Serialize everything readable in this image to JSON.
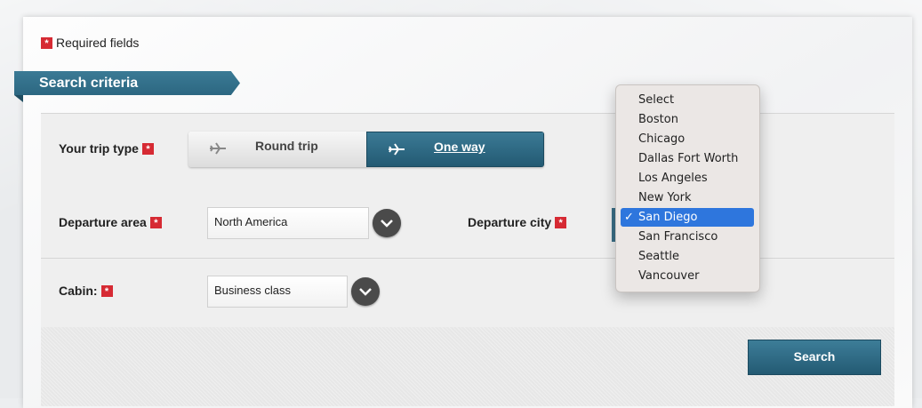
{
  "legend": {
    "required_text": "Required fields",
    "star": "*"
  },
  "section": {
    "title": "Search criteria"
  },
  "trip_type": {
    "label": "Your trip type",
    "options": [
      {
        "label": "Round trip",
        "active": false
      },
      {
        "label": "One way",
        "active": true
      }
    ]
  },
  "departure_area": {
    "label": "Departure area",
    "value": "North America"
  },
  "departure_city": {
    "label": "Departure city"
  },
  "cabin": {
    "label": "Cabin:",
    "value": "Business class"
  },
  "search_button": {
    "label": "Search"
  },
  "city_dropdown": {
    "options": [
      "Select",
      "Boston",
      "Chicago",
      "Dallas Fort Worth",
      "Los Angeles",
      "New York",
      "San Diego",
      "San Francisco",
      "Seattle",
      "Vancouver"
    ],
    "selected": "San Diego",
    "check": "✓"
  },
  "colors": {
    "accent": "#2c6781",
    "required": "#d62a33",
    "selection": "#2e76dd"
  },
  "icons": {
    "plane_round": "plane-icon",
    "plane_oneway": "plane-icon",
    "chevron": "chevron-down-icon"
  }
}
